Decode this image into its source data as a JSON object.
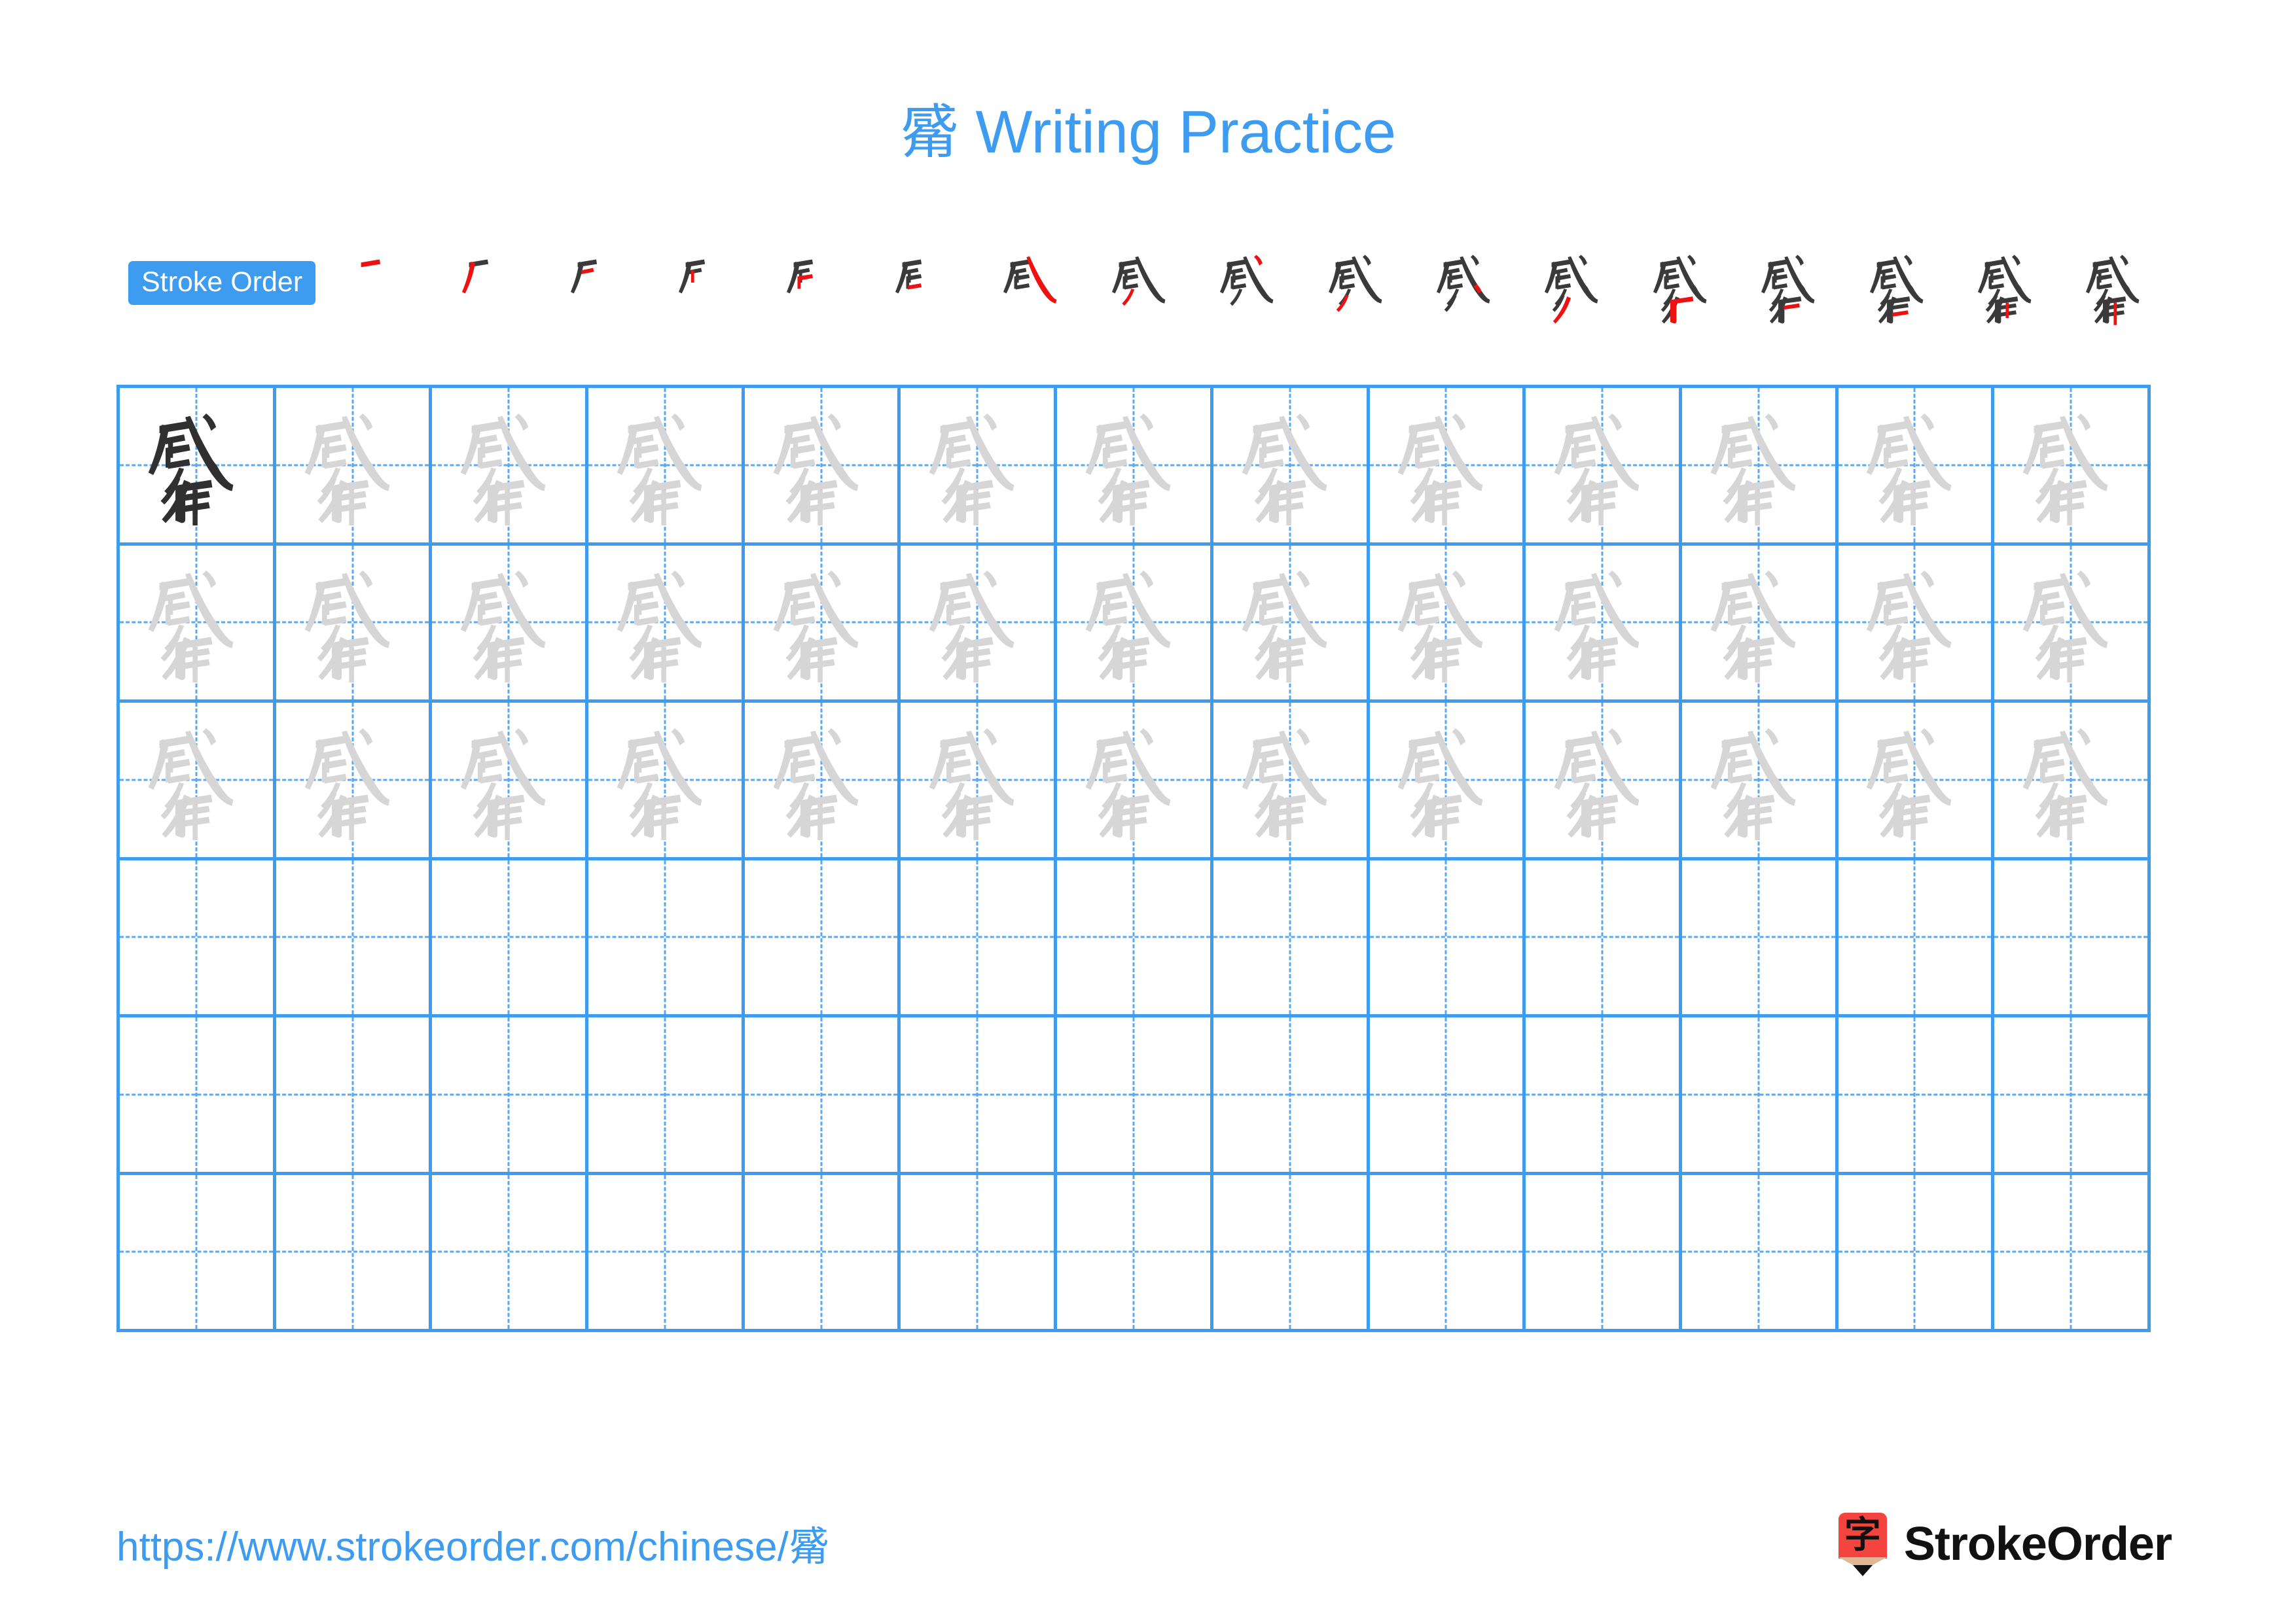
{
  "page": {
    "character": "觱",
    "title_suffix": " Writing Practice"
  },
  "stroke_order": {
    "badge_label": "Stroke Order",
    "total_steps": 17,
    "accent_color": "#3d9bf0",
    "done_stroke_color": "#3a3a3a",
    "new_stroke_color": "#ee1111",
    "steps": [
      {
        "index": 1,
        "strokes_drawn": 1,
        "new_stroke_name": "heng"
      },
      {
        "index": 2,
        "strokes_drawn": 2,
        "new_stroke_name": "pie"
      },
      {
        "index": 3,
        "strokes_drawn": 3,
        "new_stroke_name": "heng"
      },
      {
        "index": 4,
        "strokes_drawn": 4,
        "new_stroke_name": "shu"
      },
      {
        "index": 5,
        "strokes_drawn": 5,
        "new_stroke_name": "heng-zhe"
      },
      {
        "index": 6,
        "strokes_drawn": 6,
        "new_stroke_name": "heng"
      },
      {
        "index": 7,
        "strokes_drawn": 7,
        "new_stroke_name": "xie-gou"
      },
      {
        "index": 8,
        "strokes_drawn": 8,
        "new_stroke_name": "pie"
      },
      {
        "index": 9,
        "strokes_drawn": 9,
        "new_stroke_name": "dian"
      },
      {
        "index": 10,
        "strokes_drawn": 10,
        "new_stroke_name": "pie"
      },
      {
        "index": 11,
        "strokes_drawn": 11,
        "new_stroke_name": "dian"
      },
      {
        "index": 12,
        "strokes_drawn": 12,
        "new_stroke_name": "pie"
      },
      {
        "index": 13,
        "strokes_drawn": 13,
        "new_stroke_name": "heng-zhe-gou"
      },
      {
        "index": 14,
        "strokes_drawn": 14,
        "new_stroke_name": "heng"
      },
      {
        "index": 15,
        "strokes_drawn": 15,
        "new_stroke_name": "heng"
      },
      {
        "index": 16,
        "strokes_drawn": 16,
        "new_stroke_name": "shu"
      },
      {
        "index": 17,
        "strokes_drawn": 17,
        "new_stroke_name": "shu"
      }
    ]
  },
  "practice_grid": {
    "columns": 13,
    "rows": 6,
    "grid_line_color": "#3d9bf0",
    "guide_line_color": "#5aa8f2",
    "model_glyph_color": "#303030",
    "trace_glyph_color": "#d6d6d6",
    "row_types": [
      "model-then-trace",
      "trace",
      "trace",
      "blank",
      "blank",
      "blank"
    ]
  },
  "footer": {
    "url_prefix": "https://www.strokeorder.com/chinese/",
    "url_character": "觱",
    "brand_name": "StrokeOrder",
    "brand_mark_character": "字",
    "brand_mark_color": "#f4443f"
  }
}
